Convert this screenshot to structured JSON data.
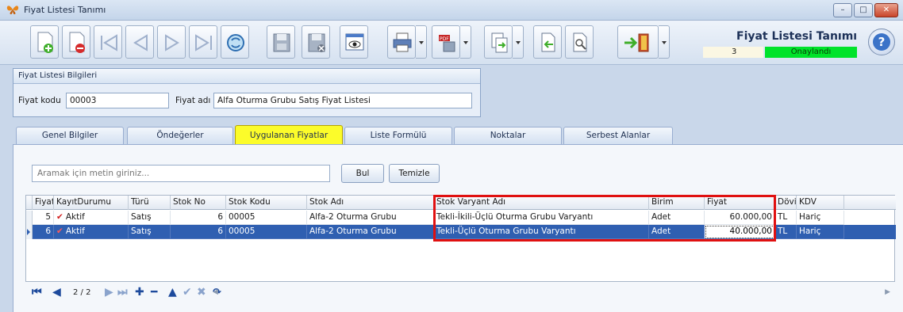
{
  "window": {
    "title": "Fiyat Listesi Tanımı",
    "min": "–",
    "max": "□",
    "close": "✕"
  },
  "header": {
    "form_title": "Fiyat Listesi Tanımı",
    "record_no": "3",
    "status": "Onaylandı",
    "help": "?"
  },
  "group": {
    "title": "Fiyat Listesi Bilgileri",
    "code_label": "Fiyat kodu",
    "code_value": "00003",
    "name_label": "Fiyat adı",
    "name_value": "Alfa Oturma Grubu Satış Fiyat Listesi"
  },
  "tabs": [
    {
      "label": "Genel Bilgiler"
    },
    {
      "label": "Öndeğerler"
    },
    {
      "label": "Uygulanan Fiyatlar"
    },
    {
      "label": "Liste Formülü"
    },
    {
      "label": "Noktalar"
    },
    {
      "label": "Serbest Alanlar"
    }
  ],
  "search": {
    "placeholder": "Aramak için metin giriniz...",
    "find_label": "Bul",
    "clear_label": "Temizle"
  },
  "grid": {
    "columns": [
      "Fiyat",
      "KayıtDurumu",
      "Türü",
      "Stok No",
      "Stok Kodu",
      "Stok Adı",
      "Stok Varyant Adı",
      "Birim",
      "Fiyat",
      "Döviz",
      "KDV"
    ],
    "rows": [
      {
        "fiyat": "5",
        "durum": "Aktif",
        "turu": "Satış",
        "stok_no": "6",
        "stok_kodu": "00005",
        "stok_adi": "Alfa-2 Oturma Grubu",
        "varyant": "Tekli-İkili-Üçlü Oturma Grubu Varyantı",
        "birim": "Adet",
        "tutar": "60.000,00",
        "doviz": "TL",
        "kdv": "Hariç"
      },
      {
        "fiyat": "6",
        "durum": "Aktif",
        "turu": "Satış",
        "stok_no": "6",
        "stok_kodu": "00005",
        "stok_adi": "Alfa-2 Oturma Grubu",
        "varyant": "Tekli-Üçlü Oturma Grubu Varyantı",
        "birim": "Adet",
        "tutar": "40.000,00",
        "doviz": "TL",
        "kdv": "Hariç"
      }
    ]
  },
  "navigator": {
    "count": "2 / 2"
  },
  "colors": {
    "status_green": "#00e32a",
    "active_tab": "#fcfc2a",
    "selection": "#2f5fb1",
    "highlight": "#e01010"
  }
}
